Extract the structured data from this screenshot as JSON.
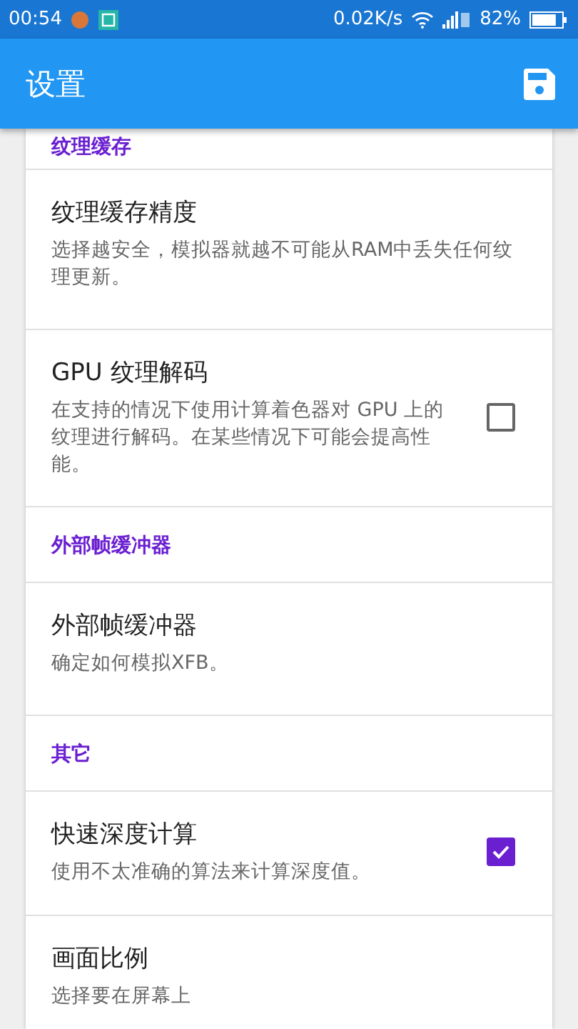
{
  "status_bar": {
    "time": "00:54",
    "net_speed": "0.02K/s",
    "battery": "82%"
  },
  "app_bar": {
    "title": "设置"
  },
  "sections": [
    {
      "header": "纹理缓存",
      "items": [
        {
          "kind": "text",
          "title": "纹理缓存精度",
          "summary": "选择越安全，模拟器就越不可能从RAM中丢失任何纹理更新。"
        },
        {
          "kind": "checkbox",
          "title": "GPU 纹理解码",
          "summary": "在支持的情况下使用计算着色器对 GPU 上的纹理进行解码。在某些情况下可能会提高性能。",
          "checked": false
        }
      ]
    },
    {
      "header": "外部帧缓冲器",
      "items": [
        {
          "kind": "text",
          "title": "外部帧缓冲器",
          "summary": "确定如何模拟XFB。"
        }
      ]
    },
    {
      "header": "其它",
      "items": [
        {
          "kind": "checkbox",
          "title": "快速深度计算",
          "summary": "使用不太准确的算法来计算深度值。",
          "checked": true
        },
        {
          "kind": "text",
          "title": "画面比例",
          "summary": "选择要在屏幕上"
        }
      ]
    }
  ]
}
